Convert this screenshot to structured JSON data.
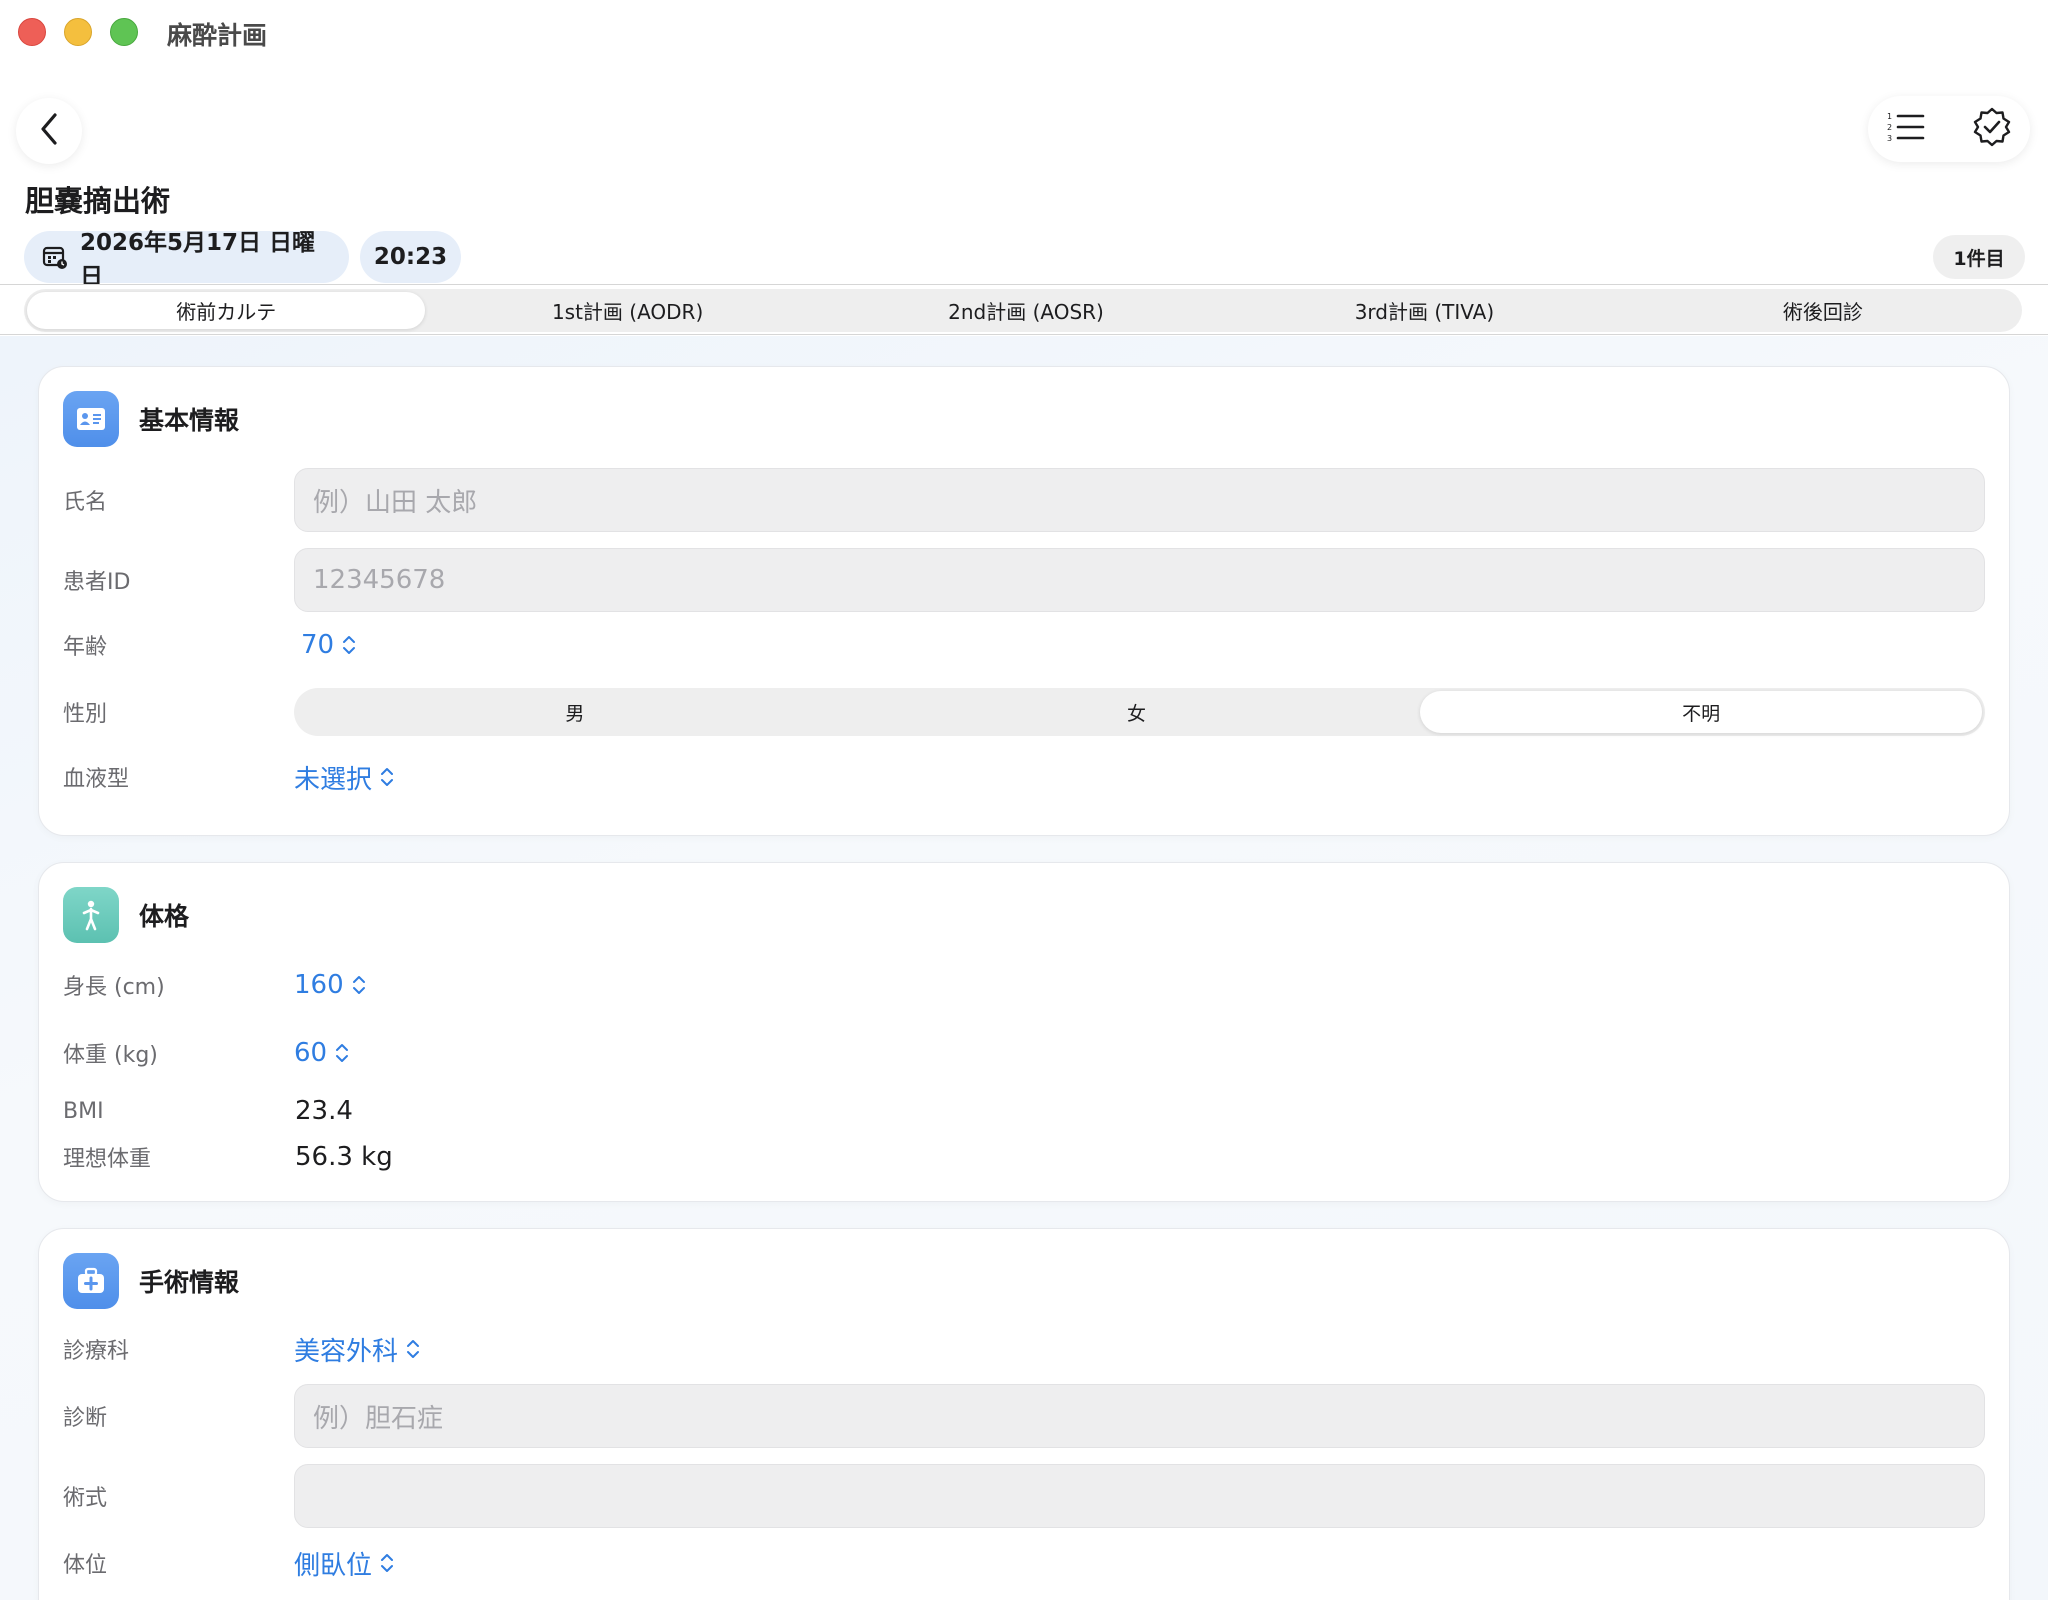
{
  "app": {
    "title": "麻酔計画"
  },
  "header": {
    "page_title": "胆嚢摘出術",
    "date": "2026年5月17日 日曜日",
    "time": "20:23",
    "record_count": "1件目"
  },
  "tabs": [
    {
      "label": "術前カルテ",
      "active": true
    },
    {
      "label": "1st計画 (AODR)",
      "active": false
    },
    {
      "label": "2nd計画 (AOSR)",
      "active": false
    },
    {
      "label": "3rd計画 (TIVA)",
      "active": false
    },
    {
      "label": "術後回診",
      "active": false
    }
  ],
  "basic_info": {
    "title": "基本情報",
    "name_label": "氏名",
    "name_placeholder": "例）山田 太郎",
    "patient_id_label": "患者ID",
    "patient_id_placeholder": "12345678",
    "age_label": "年齢",
    "age_value": "70",
    "sex_label": "性別",
    "sex_options": [
      "男",
      "女",
      "不明"
    ],
    "sex_selected": "不明",
    "blood_label": "血液型",
    "blood_value": "未選択"
  },
  "physique": {
    "title": "体格",
    "height_label": "身長 (cm)",
    "height_value": "160",
    "weight_label": "体重 (kg)",
    "weight_value": "60",
    "bmi_label": "BMI",
    "bmi_value": "23.4",
    "ideal_label": "理想体重",
    "ideal_value": "56.3 kg"
  },
  "surgery": {
    "title": "手術情報",
    "dept_label": "診療科",
    "dept_value": "美容外科",
    "diagnosis_label": "診断",
    "diagnosis_placeholder": "例）胆石症",
    "procedure_label": "術式",
    "procedure_value": "",
    "position_label": "体位",
    "position_value": "側臥位"
  },
  "icons": {
    "back": "chevron-left-icon",
    "list": "numbered-list-icon",
    "check": "checkmark-seal-icon",
    "calendar": "calendar-icon",
    "id_card": "id-card-icon",
    "person": "person-standing-icon",
    "medkit": "medical-kit-icon"
  },
  "colors": {
    "accent": "#2f7de1",
    "pill_bg": "#e6eef9",
    "icon_blue": "#5a96ee",
    "icon_teal": "#6ccbbc"
  }
}
